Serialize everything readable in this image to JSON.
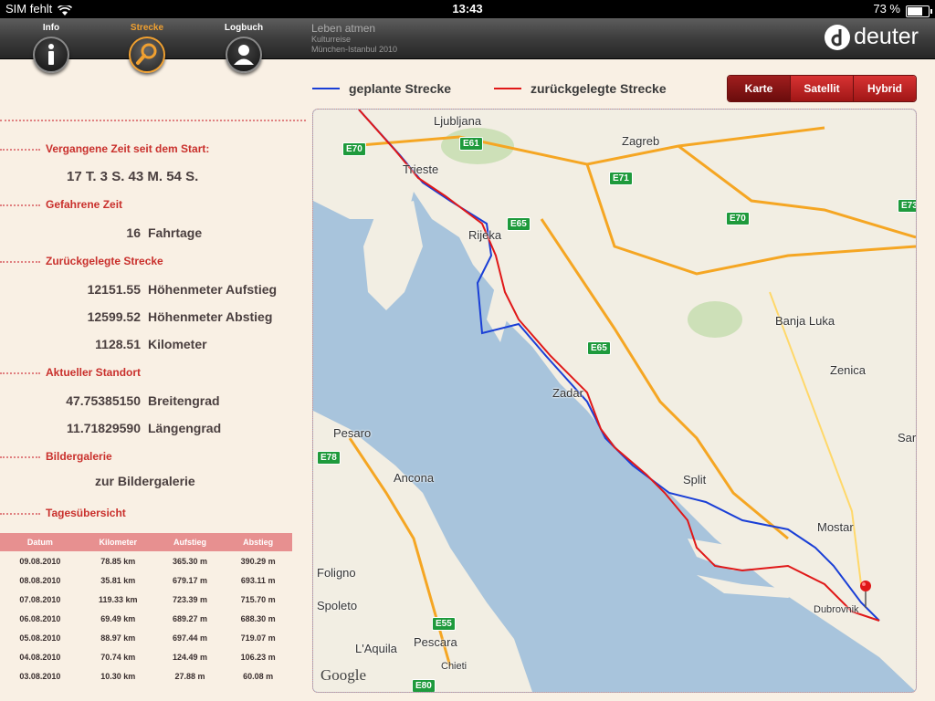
{
  "status": {
    "carrier": "SIM fehlt",
    "time": "13:43",
    "battery": "73 %"
  },
  "nav": {
    "tabs": [
      {
        "label": "Info"
      },
      {
        "label": "Strecke"
      },
      {
        "label": "Logbuch"
      }
    ],
    "trip": {
      "title": "Leben atmen",
      "line1": "Kulturreise",
      "line2": "München-Istanbul 2010"
    },
    "brand": "deuter"
  },
  "stats": {
    "elapsed_title": "Vergangene Zeit seit dem Start:",
    "elapsed_value": "17 T. 3 S. 43 M. 54 S.",
    "riding_title": "Gefahrene Zeit",
    "riding_num": "16",
    "riding_unit": "Fahrtage",
    "distance_title": "Zurückgelegte Strecke",
    "ascent_num": "12151.55",
    "ascent_unit": "Höhenmeter Aufstieg",
    "descent_num": "12599.52",
    "descent_unit": "Höhenmeter Abstieg",
    "km_num": "1128.51",
    "km_unit": "Kilometer",
    "location_title": "Aktueller Standort",
    "lat_num": "47.75385150",
    "lat_unit": "Breitengrad",
    "lon_num": "11.71829590",
    "lon_unit": "Längengrad",
    "gallery_title": "Bildergalerie",
    "gallery_link": "zur Bildergalerie",
    "daily_title": "Tagesübersicht"
  },
  "table": {
    "headers": [
      "Datum",
      "Kilometer",
      "Aufstieg",
      "Abstieg"
    ],
    "rows": [
      [
        "09.08.2010",
        "78.85  km",
        "365.30  m",
        "390.29  m"
      ],
      [
        "08.08.2010",
        "35.81  km",
        "679.17  m",
        "693.11  m"
      ],
      [
        "07.08.2010",
        "119.33  km",
        "723.39  m",
        "715.70  m"
      ],
      [
        "06.08.2010",
        "69.49  km",
        "689.27  m",
        "688.30  m"
      ],
      [
        "05.08.2010",
        "88.97  km",
        "697.44  m",
        "719.07  m"
      ],
      [
        "04.08.2010",
        "70.74  km",
        "124.49  m",
        "106.23  m"
      ],
      [
        "03.08.2010",
        "10.30  km",
        "27.88  m",
        "60.08  m"
      ]
    ]
  },
  "legend": {
    "planned": "geplante Strecke",
    "traveled": "zurückgelegte Strecke",
    "planned_color": "#1a3fd6",
    "traveled_color": "#e01818"
  },
  "map_buttons": [
    "Karte",
    "Satellit",
    "Hybrid"
  ],
  "map": {
    "google": "Google",
    "cities": [
      "Ljubljana",
      "Zagreb",
      "Trieste",
      "Rijeka",
      "Zadar",
      "Split",
      "Banja Luka",
      "Pesaro",
      "Ancona",
      "Mostar",
      "Pescara",
      "Dubrovnik",
      "Zenica",
      "Sarajevo",
      "Foligno",
      "Spoleto",
      "Chieti",
      "L'Aquila"
    ],
    "roads": [
      "E61",
      "E70",
      "E71",
      "E65",
      "E70",
      "E73",
      "E65",
      "E78",
      "E55",
      "E80"
    ]
  }
}
